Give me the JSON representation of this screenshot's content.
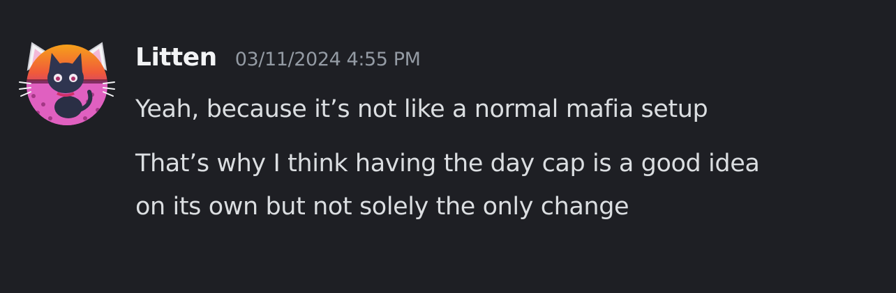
{
  "message": {
    "author": "Litten",
    "timestamp": "03/11/2024 4:55 PM",
    "lines": [
      "Yeah, because it’s not like a normal mafia setup",
      "That’s why I think having the day cap is a good idea",
      "on its own but not solely the only change"
    ]
  },
  "colors": {
    "background": "#1e1f24",
    "username": "#f2f3f5",
    "timestamp": "#949ba4",
    "text": "#dbdee1"
  },
  "icons": {
    "avatar": "black-cat-avatar-icon"
  }
}
